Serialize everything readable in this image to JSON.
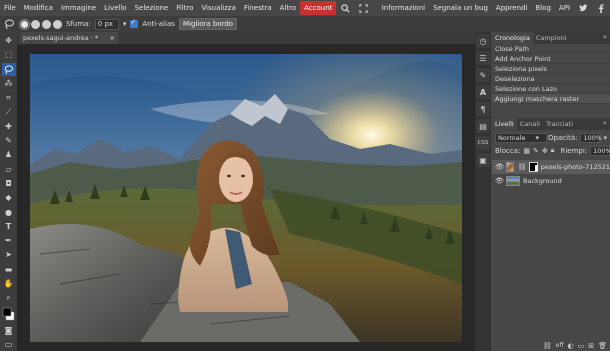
{
  "menu": {
    "items": [
      "File",
      "Modifica",
      "Immagine",
      "Livello",
      "Selezione",
      "Filtro",
      "Visualizza",
      "Finestra",
      "Altro"
    ],
    "account": "Account",
    "right_links": [
      "Informazioni",
      "Segnala un bug",
      "Apprendi",
      "Blog",
      "API"
    ],
    "icons": [
      "search-icon",
      "fullscreen-icon",
      "twitter-icon",
      "facebook-icon"
    ]
  },
  "options": {
    "feather_label": "Sfuma:",
    "feather_value": "0 px",
    "antialias_label": "Anti-alias",
    "refine_button": "Migliora bordo"
  },
  "document": {
    "tab_title": "pexels-sagui-andrea · *",
    "close": "×"
  },
  "history": {
    "tabs": [
      "Cronologia",
      "Campioni"
    ],
    "items": [
      "Close Path",
      "Add Anchor Point",
      "Seleziona pixels",
      "Deseleziona",
      "Selezione con Lazo",
      "Aggiungi maschera raster"
    ]
  },
  "layers": {
    "tabs": [
      "Livelli",
      "Canali",
      "Tracciati"
    ],
    "blend_mode": "Normale",
    "opacity_label": "Opacità:",
    "opacity_value": "100%",
    "lock_label": "Blocca:",
    "fill_label": "Riempi:",
    "fill_value": "100%",
    "items": [
      {
        "name": "pexels-photo-712521",
        "active": true
      },
      {
        "name": "Background",
        "active": false
      }
    ]
  },
  "colors": {
    "accent": "#c7312f",
    "selection_blue": "#2b5ea3",
    "panel_bg": "#474747"
  }
}
